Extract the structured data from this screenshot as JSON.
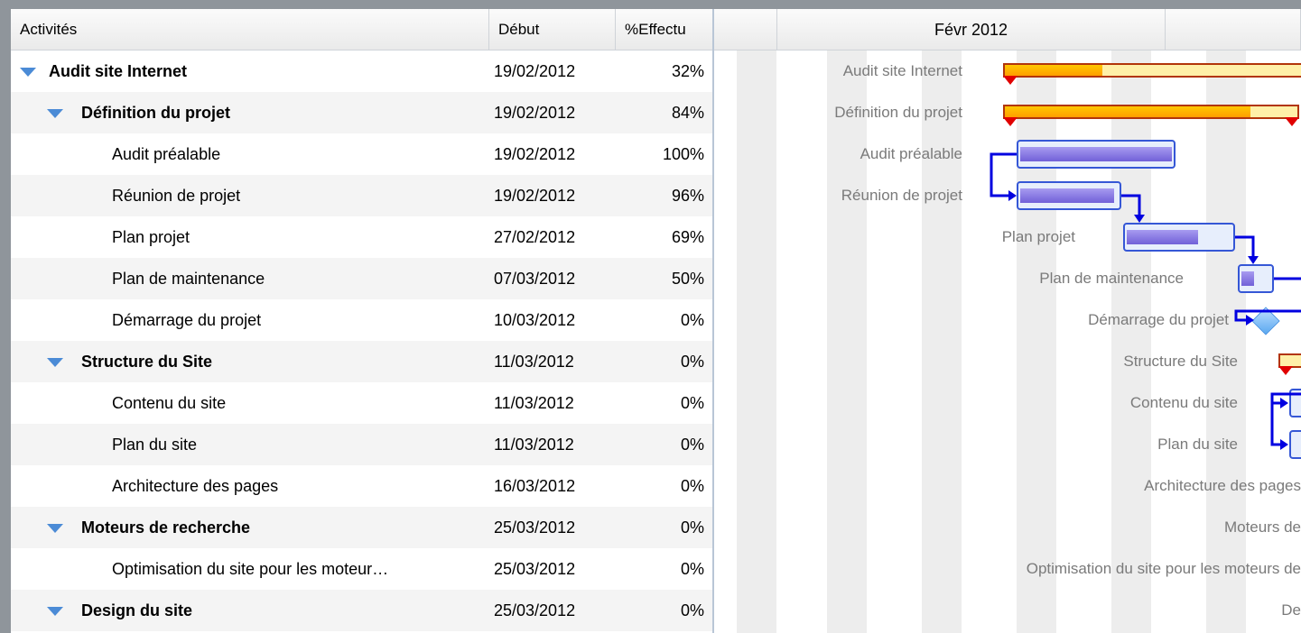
{
  "columns": {
    "activities": "Activités",
    "start": "Début",
    "pct": "%Effectu"
  },
  "timeline": {
    "month": "Févr 2012"
  },
  "colors": {
    "summary": "#ffb300",
    "task": "#7a68dc",
    "link": "#0000e0",
    "milestone": "#5aa8f0"
  },
  "rows": [
    {
      "name": "Audit site Internet",
      "start": "19/02/2012",
      "pct": "32%",
      "level": 0,
      "type": "summary",
      "progress": 0.32
    },
    {
      "name": "Définition du projet",
      "start": "19/02/2012",
      "pct": "84%",
      "level": 1,
      "type": "summary",
      "progress": 0.84
    },
    {
      "name": "Audit préalable",
      "start": "19/02/2012",
      "pct": "100%",
      "level": 2,
      "type": "task",
      "progress": 1.0
    },
    {
      "name": "Réunion de projet",
      "start": "19/02/2012",
      "pct": "96%",
      "level": 2,
      "type": "task",
      "progress": 0.96
    },
    {
      "name": "Plan projet",
      "start": "27/02/2012",
      "pct": "69%",
      "level": 2,
      "type": "task",
      "progress": 0.69
    },
    {
      "name": "Plan de maintenance",
      "start": "07/03/2012",
      "pct": "50%",
      "level": 2,
      "type": "task",
      "progress": 0.5
    },
    {
      "name": "Démarrage du projet",
      "start": "10/03/2012",
      "pct": "0%",
      "level": 2,
      "type": "milestone",
      "progress": 0
    },
    {
      "name": "Structure du Site",
      "start": "11/03/2012",
      "pct": "0%",
      "level": 1,
      "type": "summary",
      "progress": 0
    },
    {
      "name": "Contenu du site",
      "start": "11/03/2012",
      "pct": "0%",
      "level": 2,
      "type": "task",
      "progress": 0
    },
    {
      "name": "Plan du site",
      "start": "11/03/2012",
      "pct": "0%",
      "level": 2,
      "type": "task",
      "progress": 0
    },
    {
      "name": "Architecture des pages",
      "start": "16/03/2012",
      "pct": "0%",
      "level": 2,
      "type": "task",
      "progress": 0
    },
    {
      "name": "Moteurs de recherche",
      "start": "25/03/2012",
      "pct": "0%",
      "level": 1,
      "type": "summary",
      "progress": 0
    },
    {
      "name": "Optimisation du site pour les moteur…",
      "start": "25/03/2012",
      "pct": "0%",
      "level": 2,
      "type": "task",
      "progress": 0
    },
    {
      "name": "Design du site",
      "start": "25/03/2012",
      "pct": "0%",
      "level": 1,
      "type": "summary",
      "progress": 0
    }
  ],
  "gantt_labels": [
    "Audit site Internet",
    "Définition du projet",
    "Audit préalable",
    "Réunion de projet",
    "Plan projet",
    "Plan de maintenance",
    "Démarrage du projet",
    "Structure du Site",
    "Contenu du site",
    "Plan du site",
    "Architecture des pages",
    "Moteurs de",
    "Optimisation du site pour les moteurs de",
    "De"
  ]
}
